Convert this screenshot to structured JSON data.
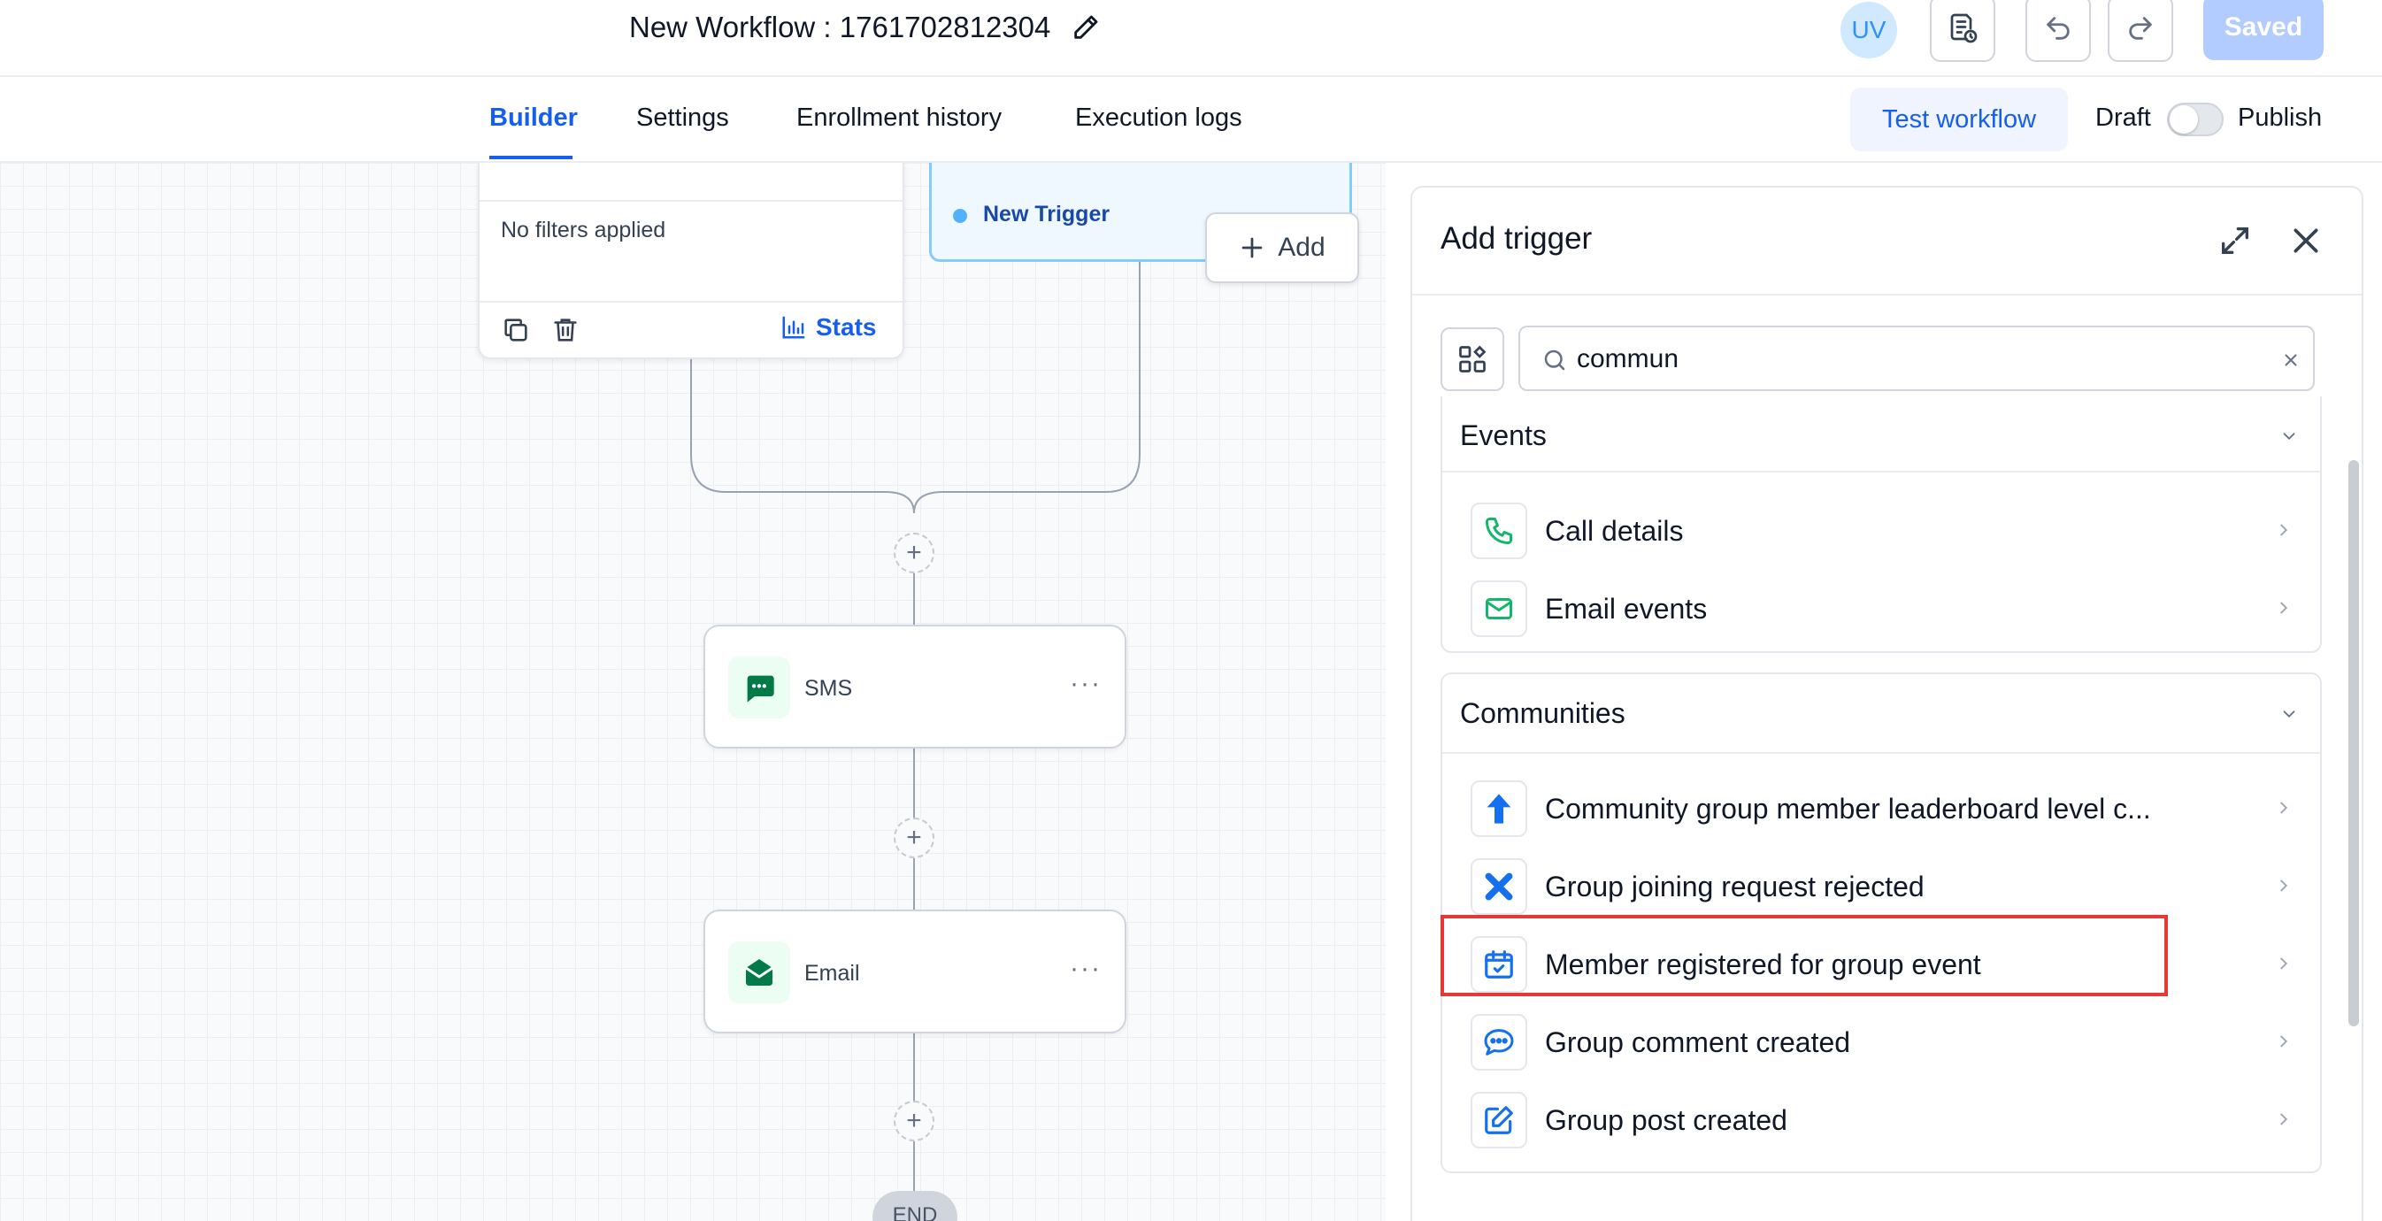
{
  "header": {
    "workflow_title": "New Workflow : 1761702812304",
    "avatar_initials": "UV",
    "saved_label": "Saved"
  },
  "nav": {
    "tabs": [
      {
        "label": "Builder",
        "active": true
      },
      {
        "label": "Settings",
        "active": false
      },
      {
        "label": "Enrollment history",
        "active": false
      },
      {
        "label": "Execution logs",
        "active": false
      }
    ],
    "test_workflow_label": "Test workflow",
    "draft_label": "Draft",
    "publish_label": "Publish",
    "publish_toggle_on": false
  },
  "canvas": {
    "filter_card": {
      "text": "No filters applied",
      "stats_label": "Stats"
    },
    "trigger_card": {
      "label": "New Trigger"
    },
    "add_label": "Add",
    "actions": [
      {
        "label": "SMS",
        "icon": "chat-icon"
      },
      {
        "label": "Email",
        "icon": "envelope-icon"
      }
    ],
    "end_label": "END"
  },
  "panel": {
    "title": "Add trigger",
    "search": {
      "value": "commun",
      "placeholder": ""
    },
    "sections": [
      {
        "title": "Events",
        "items": [
          {
            "label": "Call details",
            "icon": "phone-icon"
          },
          {
            "label": "Email events",
            "icon": "mail-icon"
          }
        ]
      },
      {
        "title": "Communities",
        "items": [
          {
            "label": "Community group member leaderboard level c...",
            "icon": "arrow-up-icon"
          },
          {
            "label": "Group joining request rejected",
            "icon": "x-icon"
          },
          {
            "label": "Member registered for group event",
            "icon": "calendar-check-icon",
            "highlighted": true
          },
          {
            "label": "Group comment created",
            "icon": "comment-icon"
          },
          {
            "label": "Group post created",
            "icon": "edit-icon"
          }
        ]
      }
    ]
  },
  "colors": {
    "primary": "#155eef",
    "highlight": "#e53935",
    "green_icon": "#12b76a",
    "blue_icon": "#1570ef"
  }
}
